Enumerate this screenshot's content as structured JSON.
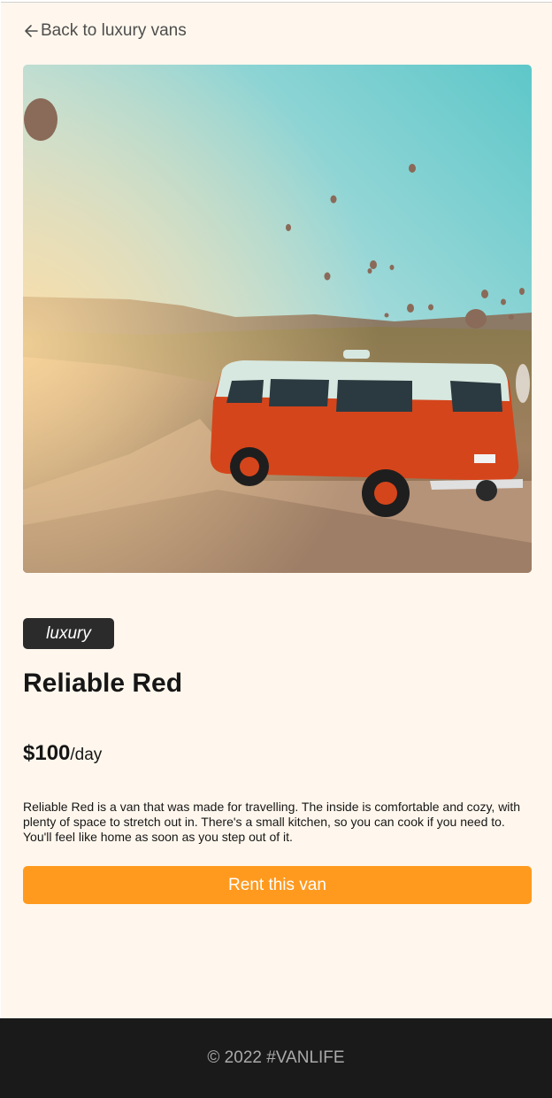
{
  "nav": {
    "back_label": "Back to luxury vans"
  },
  "van": {
    "type_badge": "luxury",
    "name": "Reliable Red",
    "price": "$100",
    "price_unit": "/day",
    "description": "Reliable Red is a van that was made for travelling. The inside is comfortable and cozy, with plenty of space to stretch out in. There's a small kitchen, so you can cook if you need to. You'll feel like home as soon as you step out of it.",
    "rent_label": "Rent this van"
  },
  "footer": {
    "copyright": "© 2022 #VANLIFE"
  },
  "colors": {
    "page_bg": "#fff7ed",
    "badge_bg": "#2b2b2b",
    "button_bg": "#ff9a1f",
    "footer_bg": "#1a1a1a"
  },
  "icons": {
    "back": "arrow-left-icon"
  }
}
